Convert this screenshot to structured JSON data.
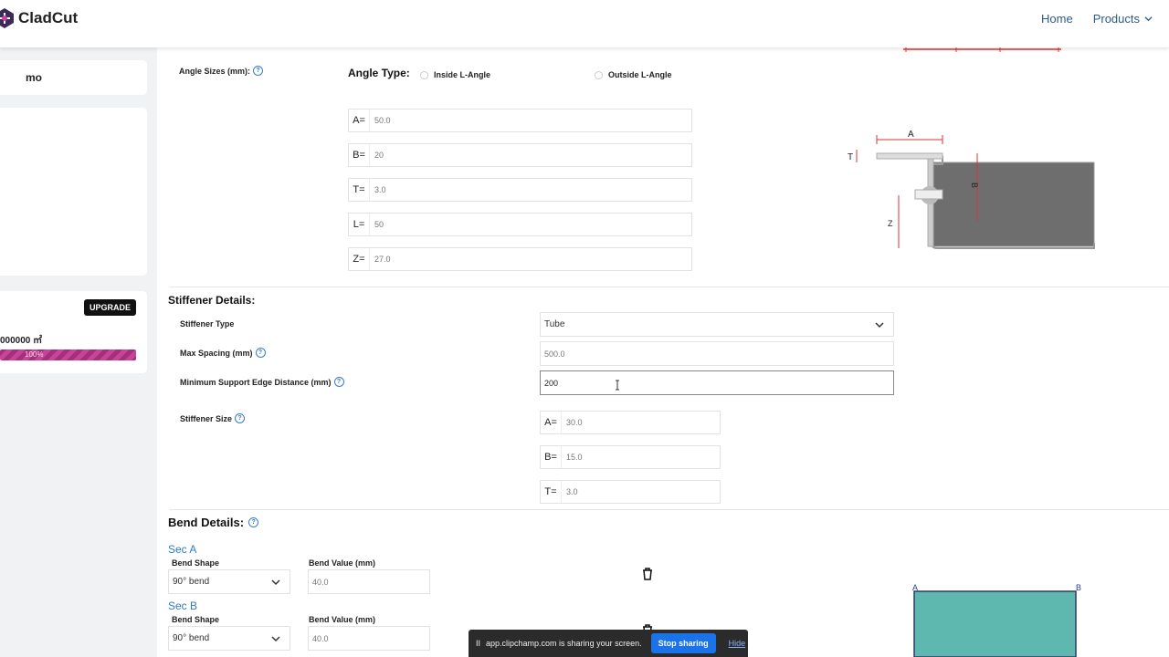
{
  "app": {
    "name": "CladCut"
  },
  "nav": {
    "home": "Home",
    "products": "Products"
  },
  "sidebar": {
    "user_name": "mo",
    "upgrade_label": "UPGRADE",
    "area_text": "000000 ㎡",
    "progress_label": "100%",
    "progress_fraction": 1.0
  },
  "angle": {
    "sizes_label": "Angle Sizes (mm):",
    "type_label": "Angle Type:",
    "option_inside": "Inside L-Angle",
    "option_outside": "Outside L-Angle",
    "fields": [
      {
        "label": "A=",
        "value": "50.0"
      },
      {
        "label": "B=",
        "value": "20"
      },
      {
        "label": "T=",
        "value": "3.0"
      },
      {
        "label": "L=",
        "value": "50"
      },
      {
        "label": "Z=",
        "value": "27.0"
      }
    ],
    "diagram": {
      "label_a": "A",
      "label_t": "T",
      "label_b": "B",
      "label_z": "Z"
    }
  },
  "stiffener": {
    "title": "Stiffener Details:",
    "type_label": "Stiffener Type",
    "type_value": "Tube",
    "max_spacing_label": "Max Spacing (mm)",
    "max_spacing_value": "500.0",
    "min_edge_label": "Minimum Support Edge Distance (mm)",
    "min_edge_value": "200",
    "size_label": "Stiffener Size",
    "sizes": [
      {
        "label": "A=",
        "value": "30.0"
      },
      {
        "label": "B=",
        "value": "15.0"
      },
      {
        "label": "T=",
        "value": "3.0"
      }
    ]
  },
  "bend": {
    "title": "Bend Details:",
    "sections": [
      {
        "title": "Sec A",
        "shape_label": "Bend Shape",
        "shape_value": "90° bend",
        "value_label": "Bend Value (mm)",
        "value": "40.0"
      },
      {
        "title": "Sec B",
        "shape_label": "Bend Shape",
        "shape_value": "90° bend",
        "value_label": "Bend Value (mm)",
        "value": "40.0"
      }
    ],
    "diagram": {
      "label_a": "A",
      "label_b": "B",
      "fill_color": "#5fb8b0"
    }
  },
  "share_bar": {
    "pause": "II",
    "message": "app.clipchamp.com is sharing your screen.",
    "stop_label": "Stop sharing",
    "hide_label": "Hide"
  }
}
